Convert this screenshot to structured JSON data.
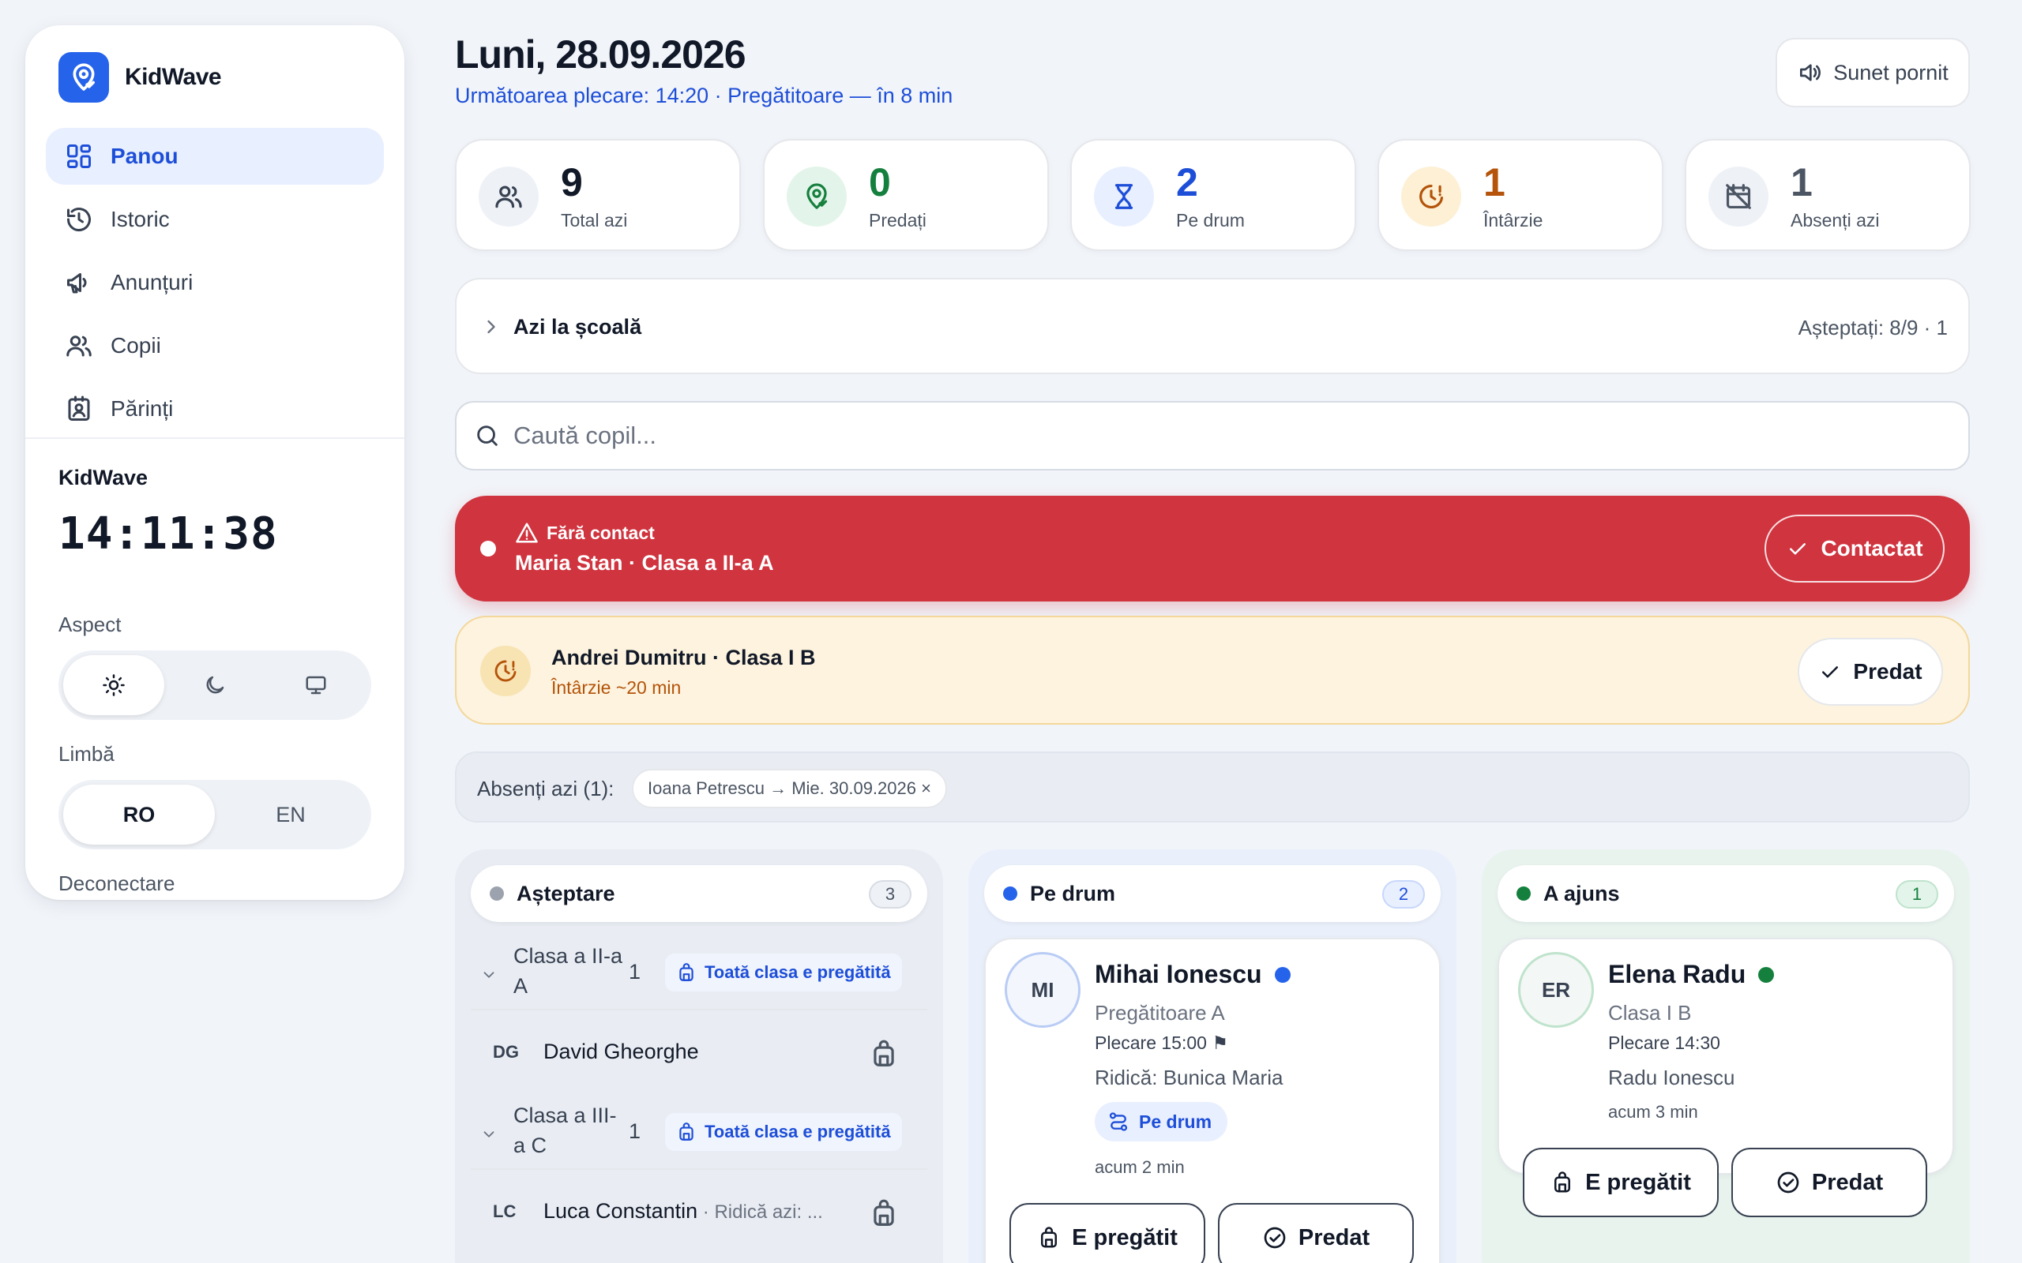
{
  "sidebar": {
    "brand": "KidWave",
    "items": [
      {
        "label": "Panou",
        "icon": "dashboard-icon",
        "active": true
      },
      {
        "label": "Istoric",
        "icon": "history-icon"
      },
      {
        "label": "Anunțuri",
        "icon": "megaphone-icon"
      },
      {
        "label": "Copii",
        "icon": "users-icon"
      },
      {
        "label": "Părinți",
        "icon": "contact-card-icon"
      }
    ],
    "app_label": "KidWave",
    "clock": "14:11:38",
    "aspect_label": "Aspect",
    "theme_options": [
      "light",
      "dark",
      "system"
    ],
    "theme_selected": "light",
    "language_label": "Limbă",
    "languages": [
      "RO",
      "EN"
    ],
    "language_selected": "RO",
    "logout": "Deconectare"
  },
  "header": {
    "date": "Luni, 28.09.2026",
    "next_departure": "Următoarea plecare: 14:20 · Pregătitoare — în 8 min",
    "sound_button": "Sunet pornit"
  },
  "stats": [
    {
      "value": "9",
      "label": "Total azi",
      "icon": "users-icon",
      "color": "#374151",
      "bg": "#eef1f6"
    },
    {
      "value": "0",
      "label": "Predați",
      "icon": "location-check-icon",
      "color": "#15803d",
      "bg": "#e3f5ea"
    },
    {
      "value": "2",
      "label": "Pe drum",
      "icon": "hourglass-icon",
      "color": "#1d4ed8",
      "bg": "#e8efff"
    },
    {
      "value": "1",
      "label": "Întârzie",
      "icon": "clock-alert-icon",
      "color": "#b45309",
      "bg": "#fdf0d5"
    },
    {
      "value": "1",
      "label": "Absenți azi",
      "icon": "calendar-off-icon",
      "color": "#4b5563",
      "bg": "#eef1f6"
    }
  ],
  "school": {
    "title": "Azi la școală",
    "waiting": "Așteptați: 8/9 · 1"
  },
  "search": {
    "placeholder": "Caută copil..."
  },
  "alert_no_contact": {
    "tag": "Fără contact",
    "child": "Maria Stan · Clasa a II-a A",
    "button": "Contactat",
    "color": "#d0343f"
  },
  "alert_late": {
    "child": "Andrei Dumitru · Clasa I B",
    "status": "Întârzie ~20 min",
    "button": "Predat"
  },
  "absent": {
    "label": "Absenți azi (1):",
    "chip": "Ioana Petrescu → Mie. 30.09.2026 ×"
  },
  "columns": {
    "waiting": {
      "title": "Așteptare",
      "count": "3",
      "dot_color": "#9ca3af",
      "groups": [
        {
          "name": "Clasa a II-a A",
          "count": "1",
          "ready": "Toată clasa e pregătită"
        },
        {
          "name": "Clasa a III-a C",
          "count": "1",
          "ready": "Toată clasa e pregătită"
        }
      ],
      "children": [
        {
          "initials": "DG",
          "name": "David Gheorghe",
          "extra": ""
        },
        {
          "initials": "LC",
          "name": "Luca Constantin",
          "extra": " · Ridică azi: ..."
        }
      ]
    },
    "on_way": {
      "title": "Pe drum",
      "count": "2",
      "dot_color": "#2563eb",
      "card": {
        "initials": "MI",
        "name": "Mihai Ionescu",
        "class": "Pregătitoare A",
        "departure": "Plecare 15:00 ⚑",
        "pickup": "Ridică: Bunica Maria",
        "badge": "Pe drum",
        "ago": "acum 2 min",
        "btn_ready": "E pregătit",
        "btn_handed": "Predat"
      }
    },
    "arrived": {
      "title": "A ajuns",
      "count": "1",
      "dot_color": "#15803d",
      "card": {
        "initials": "ER",
        "name": "Elena Radu",
        "class": "Clasa I B",
        "departure": "Plecare 14:30",
        "pickup": "Radu Ionescu",
        "ago": "acum 3 min",
        "btn_ready": "E pregătit",
        "btn_handed": "Predat"
      }
    }
  }
}
